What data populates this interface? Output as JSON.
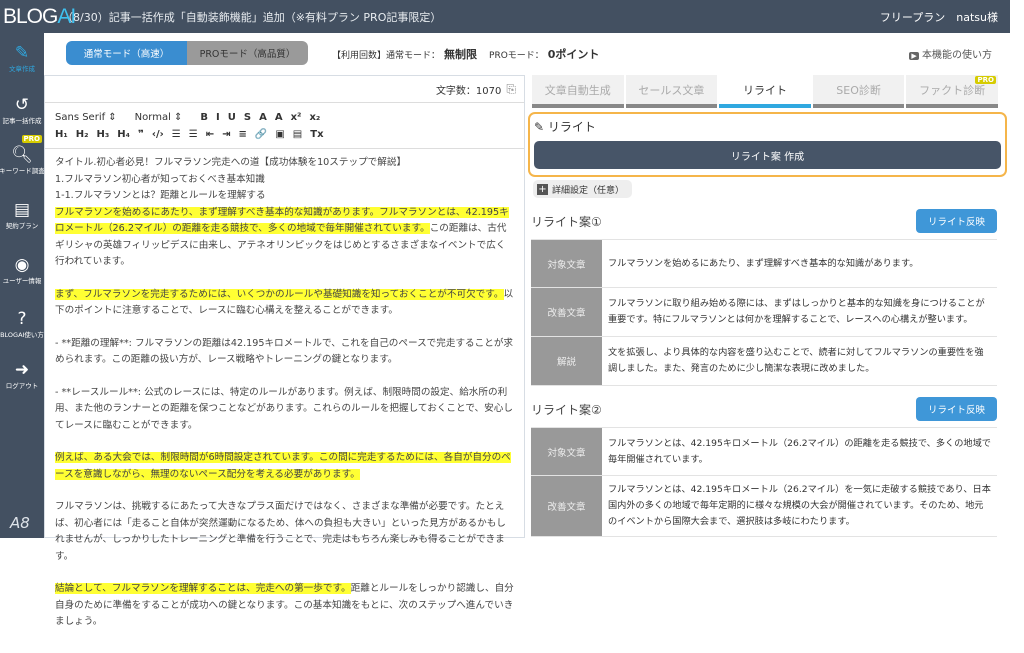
{
  "header": {
    "logo_a": "BLOG",
    "logo_b": "AI",
    "notice": "（8/30）記事一括作成「自動装飾機能」追加（※有料プラン PRO記事限定）",
    "user": "フリープラン　natsu様"
  },
  "sidebar": {
    "items": [
      {
        "icon": "pencil-icon",
        "label": "文章作成"
      },
      {
        "icon": "history-icon",
        "label": "記事一括作成"
      },
      {
        "icon": "search-icon",
        "label": "キーワード調査",
        "badge": "PRO"
      },
      {
        "icon": "document-icon",
        "label": "契約プラン"
      },
      {
        "icon": "user-icon",
        "label": "ユーザー情報"
      },
      {
        "icon": "help-icon",
        "label": "BLOGAI使い方"
      },
      {
        "icon": "logout-icon",
        "label": "ログアウト"
      }
    ],
    "footer": "A8"
  },
  "modes": {
    "normal": "通常モード（高速）",
    "pro": "PROモード（高品質）"
  },
  "usage": {
    "label": "【利用回数】通常モード：",
    "normal": "無制限",
    "pro_label": "PROモード：",
    "pro": "0ポイント"
  },
  "howto": "本機能の使い方",
  "editor": {
    "count_label": "文字数：1070",
    "toolbar_row1": [
      "Sans Serif ⇕",
      "Normal ⇕",
      "B",
      "I",
      "U",
      "S",
      "A",
      "A",
      "x²",
      "x₂"
    ],
    "toolbar_row2": [
      "H₁",
      "H₂",
      "H₃",
      "H₄",
      "❞",
      "‹/›",
      "☰",
      "☰",
      "⇤",
      "⇥",
      "≡",
      "🔗",
      "▣",
      "▤",
      "Tx"
    ],
    "paragraphs": [
      [
        {
          "t": "タイトル.初心者必見！フルマラソン完走への道【成功体験を10ステップで解説】"
        }
      ],
      [
        {
          "t": "1.フルマラソン初心者が知っておくべき基本知識"
        }
      ],
      [
        {
          "t": "1-1.フルマラソンとは？距離とルールを理解する"
        }
      ],
      [
        {
          "t": "フルマラソンを始めるにあたり、まず理解すべき基本的な知識があります。フルマラソンとは、42.195キロメートル（26.2マイル）の距離を走る競技で、多くの地域で毎年開催されています。",
          "hl": true
        },
        {
          "t": "この距離は、古代ギリシャの英雄フィリッピデスに由来し、アテネオリンピックをはじめとするさまざまなイベントで広く行われています。"
        }
      ],
      [
        {
          "t": "まず、フルマラソンを完走するためには、いくつかのルールや基礎知識を知っておくことが不可欠です。",
          "hl": true
        },
        {
          "t": "以下のポイントに注意することで、レースに臨む心構えを整えることができます。"
        }
      ],
      [
        {
          "t": "- **距離の理解**: フルマラソンの距離は42.195キロメートルで、これを自己のペースで完走することが求められます。この距離の扱い方が、レース戦略やトレーニングの鍵となります。"
        }
      ],
      [
        {
          "t": "- **レースルール**: 公式のレースには、特定のルールがあります。例えば、制限時間の設定、給水所の利用、また他のランナーとの距離を保つことなどがあります。これらのルールを把握しておくことで、安心してレースに臨むことができます。"
        }
      ],
      [
        {
          "t": "例えば、ある大会では、制限時間が6時間設定されています。この間に完走するためには、各自が自分のペースを意識しながら、無理のないペース配分を考える必要があります。",
          "hl": true
        }
      ],
      [
        {
          "t": "フルマラソンは、挑戦するにあたって大きなプラス面だけではなく、さまざまな準備が必要です。たとえば、初心者には「走ること自体が突然運動になるため、体への負担も大きい」といった見方があるかもしれませんが、しっかりしたトレーニングと準備を行うことで、完走はもちろん楽しみも得ることができます。"
        }
      ],
      [
        {
          "t": "結論として、フルマラソンを理解することは、完走への第一歩です。",
          "hl": true
        },
        {
          "t": "距離とルールをしっかり認識し、自分自身のために準備をすることが成功への鍵となります。この基本知識をもとに、次のステップへ進んでいきましょう。"
        }
      ]
    ]
  },
  "tabs": [
    {
      "label": "文章自動生成"
    },
    {
      "label": "セールス文章"
    },
    {
      "label": "リライト",
      "active": true
    },
    {
      "label": "SEO診断"
    },
    {
      "label": "ファクト診断",
      "badge": "PRO"
    }
  ],
  "rewrite": {
    "title": "リライト",
    "create_button": "リライト案 作成",
    "detail_button": "詳細設定（任意）"
  },
  "proposals": [
    {
      "title": "リライト案①",
      "apply": "リライト反映",
      "rows": [
        {
          "k": "対象文章",
          "v": "フルマラソンを始めるにあたり、まず理解すべき基本的な知識があります。"
        },
        {
          "k": "改善文章",
          "v": "フルマラソンに取り組み始める際には、まずはしっかりと基本的な知識を身につけることが重要です。特にフルマラソンとは何かを理解することで、レースへの心構えが整います。"
        },
        {
          "k": "解説",
          "v": "文を拡張し、より具体的な内容を盛り込むことで、読者に対してフルマラソンの重要性を強調しました。また、発言のために少し簡潔な表現に改めました。"
        }
      ]
    },
    {
      "title": "リライト案②",
      "apply": "リライト反映",
      "rows": [
        {
          "k": "対象文章",
          "v": "フルマラソンとは、42.195キロメートル（26.2マイル）の距離を走る競技で、多くの地域で毎年開催されています。"
        },
        {
          "k": "改善文章",
          "v": "フルマラソンとは、42.195キロメートル（26.2マイル）を一気に走破する競技であり、日本国内外の多くの地域で毎年定期的に様々な規模の大会が開催されています。そのため、地元のイベントから国際大会まで、選択肢は多岐にわたります。"
        }
      ]
    }
  ],
  "colors": {
    "header": "#435061",
    "accent": "#2fa8e0",
    "highlight": "#ffff33",
    "orange": "#f5b54a"
  }
}
